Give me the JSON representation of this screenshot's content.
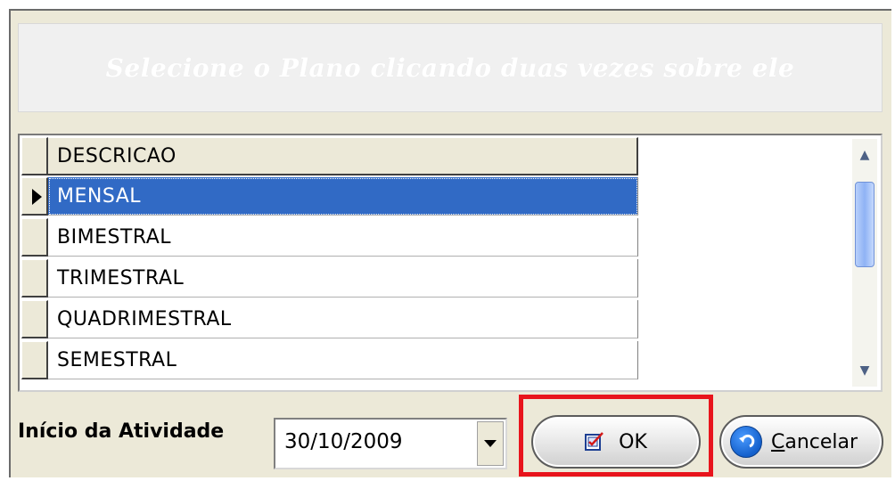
{
  "header": {
    "instruction": "Selecione o Plano clicando duas vezes sobre ele"
  },
  "grid": {
    "column_header": "DESCRICAO",
    "rows": [
      {
        "label": "MENSAL",
        "selected": true
      },
      {
        "label": "BIMESTRAL",
        "selected": false
      },
      {
        "label": "TRIMESTRAL",
        "selected": false
      },
      {
        "label": "QUADRIMESTRAL",
        "selected": false
      },
      {
        "label": "SEMESTRAL",
        "selected": false
      }
    ],
    "scroll_up_glyph": "▲",
    "scroll_down_glyph": "▼"
  },
  "form": {
    "start_label": "Início da Atividade",
    "start_date": "30/10/2009"
  },
  "buttons": {
    "ok_label": "OK",
    "cancel_label": "Cancelar"
  },
  "colors": {
    "selection": "#316ac5",
    "highlight_box": "#e8141c",
    "cancel_icon": "#1460cc"
  }
}
